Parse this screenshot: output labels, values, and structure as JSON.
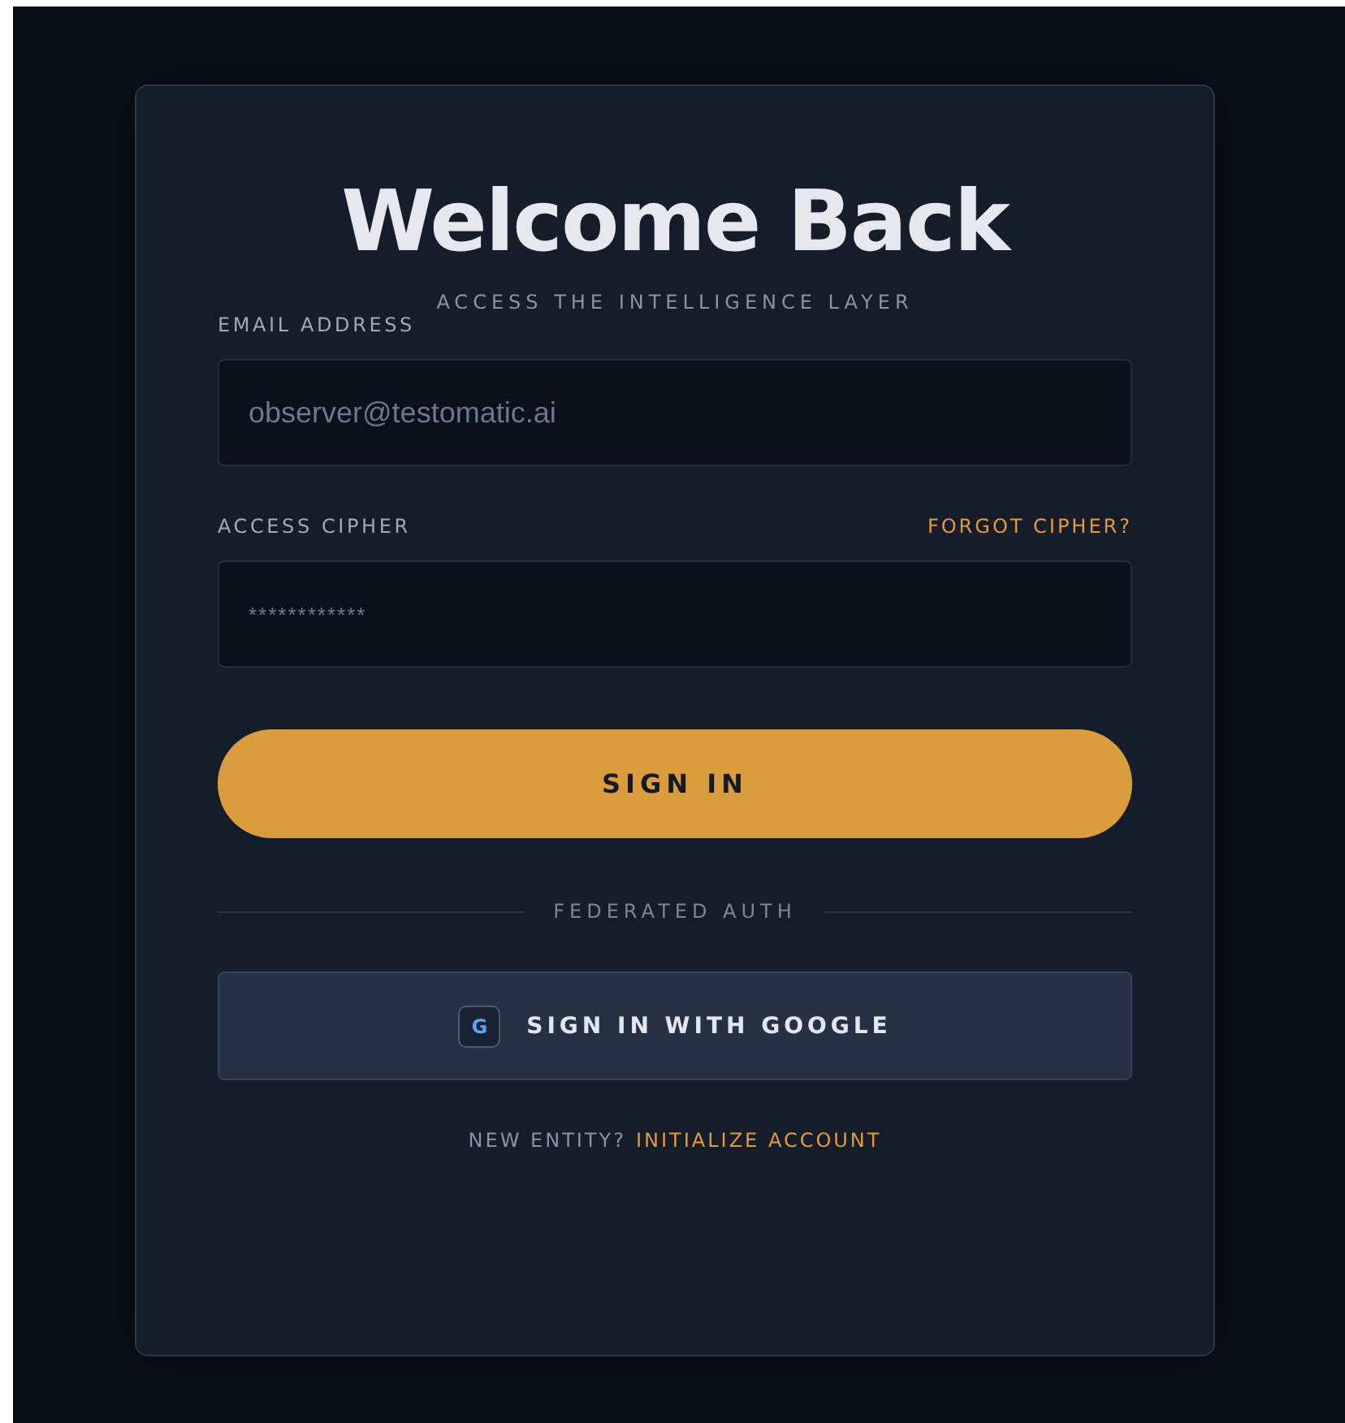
{
  "title": "Welcome Back",
  "subtitle": "ACCESS THE INTELLIGENCE LAYER",
  "fields": [
    {
      "label": "EMAIL ADDRESS",
      "placeholder": "observer@testomatic.ai"
    },
    {
      "label": "ACCESS CIPHER",
      "link": "FORGOT CIPHER?",
      "value": "************"
    }
  ],
  "submit": "SIGN IN",
  "divider": "FEDERATED AUTH",
  "google": {
    "icon": "G",
    "label": "SIGN IN WITH GOOGLE"
  },
  "footer": {
    "text": "NEW ENTITY?",
    "link": "INITIALIZE ACCOUNT"
  }
}
